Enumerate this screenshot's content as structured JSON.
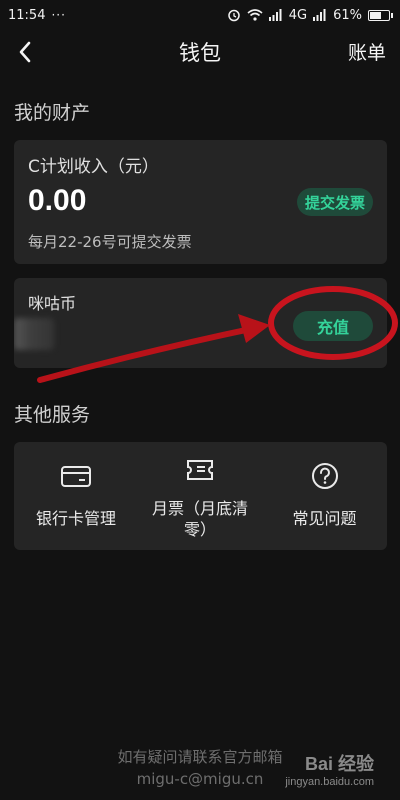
{
  "status_bar": {
    "time": "11:54",
    "dots": "···",
    "network": "4G",
    "battery": "61%",
    "battery_level": 0.61
  },
  "nav": {
    "back_icon": "chevron-left-icon",
    "title": "钱包",
    "right_label": "账单"
  },
  "assets": {
    "section_title": "我的财产",
    "income": {
      "label": "C计划收入（元）",
      "value": "0.00",
      "note": "每月22-26号可提交发票",
      "button": "提交发票"
    },
    "coin": {
      "label": "咪咕币",
      "button": "充值"
    }
  },
  "services": {
    "section_title": "其他服务",
    "items": [
      {
        "label": "银行卡管理",
        "icon": "bank-card-icon"
      },
      {
        "label": "月票（月底清零）",
        "label_line1": "月票（月底清",
        "label_line2": "零）",
        "icon": "ticket-icon"
      },
      {
        "label": "常见问题",
        "icon": "question-circle-icon"
      }
    ]
  },
  "footer": {
    "line1": "如有疑问请联系官方邮箱",
    "line2": "migu-c@migu.cn"
  },
  "watermark": {
    "brand": "Bai 经验",
    "url": "jingyan.baidu.com"
  },
  "colors": {
    "background": "#121212",
    "card": "#252525",
    "accent_green": "#34d39a",
    "accent_green_bg": "#1f4a3a",
    "annotation_red": "#c8141e"
  }
}
